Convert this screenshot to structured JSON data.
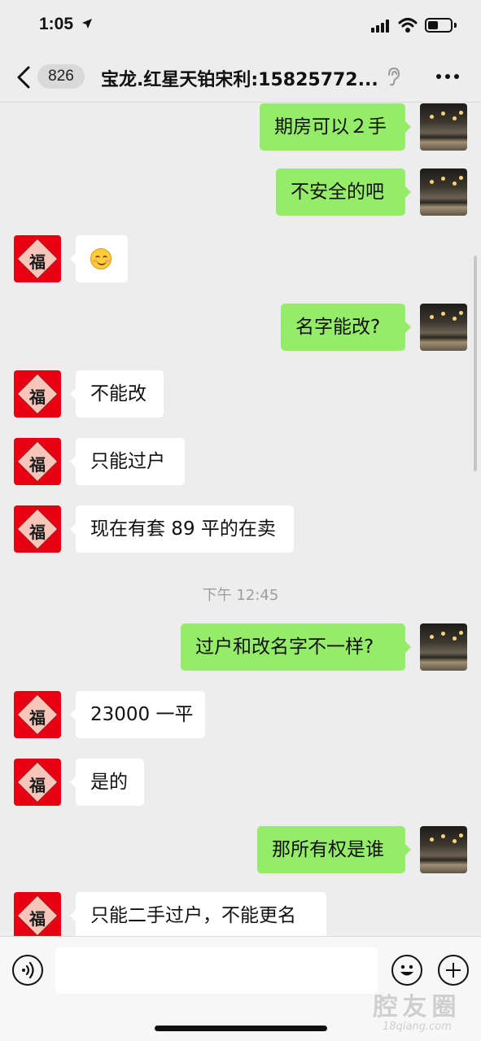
{
  "status_bar": {
    "time": "1:05",
    "battery_level": 0.45
  },
  "nav": {
    "unread_count": "826",
    "title": "宝龙.红星天铂宋利:15825772..."
  },
  "icons": {
    "back": "chevron-left-icon",
    "ear": "ear-icon",
    "more": "more-horizontal-icon",
    "voice": "voice-icon",
    "emoji": "smiley-icon",
    "plus": "plus-icon"
  },
  "colors": {
    "sent_bubble": "#95ec69",
    "received_bubble": "#ffffff",
    "background": "#ededed",
    "fu_avatar": "#e60012"
  },
  "contact_avatar_text": "福",
  "messages": [
    {
      "side": "right",
      "text": "期房可以２手"
    },
    {
      "side": "right",
      "text": "不安全的吧"
    },
    {
      "side": "left",
      "text": "",
      "emoji": "smiling-face"
    },
    {
      "side": "right",
      "text": "名字能改?"
    },
    {
      "side": "left",
      "text": "不能改"
    },
    {
      "side": "left",
      "text": "只能过户"
    },
    {
      "side": "left",
      "text": "现在有套 89 平的在卖"
    },
    {
      "type": "time",
      "text": "下午 12:45"
    },
    {
      "side": "right",
      "text": "过户和改名字不一样?"
    },
    {
      "side": "left",
      "text": "23000 一平"
    },
    {
      "side": "left",
      "text": "是的"
    },
    {
      "side": "right",
      "text": "那所有权是谁"
    },
    {
      "side": "left",
      "text": "只能二手过户，不能更名"
    }
  ],
  "input": {
    "value": "",
    "placeholder": ""
  },
  "watermark": {
    "main": "腔友圈",
    "url": "18qiang.com"
  }
}
